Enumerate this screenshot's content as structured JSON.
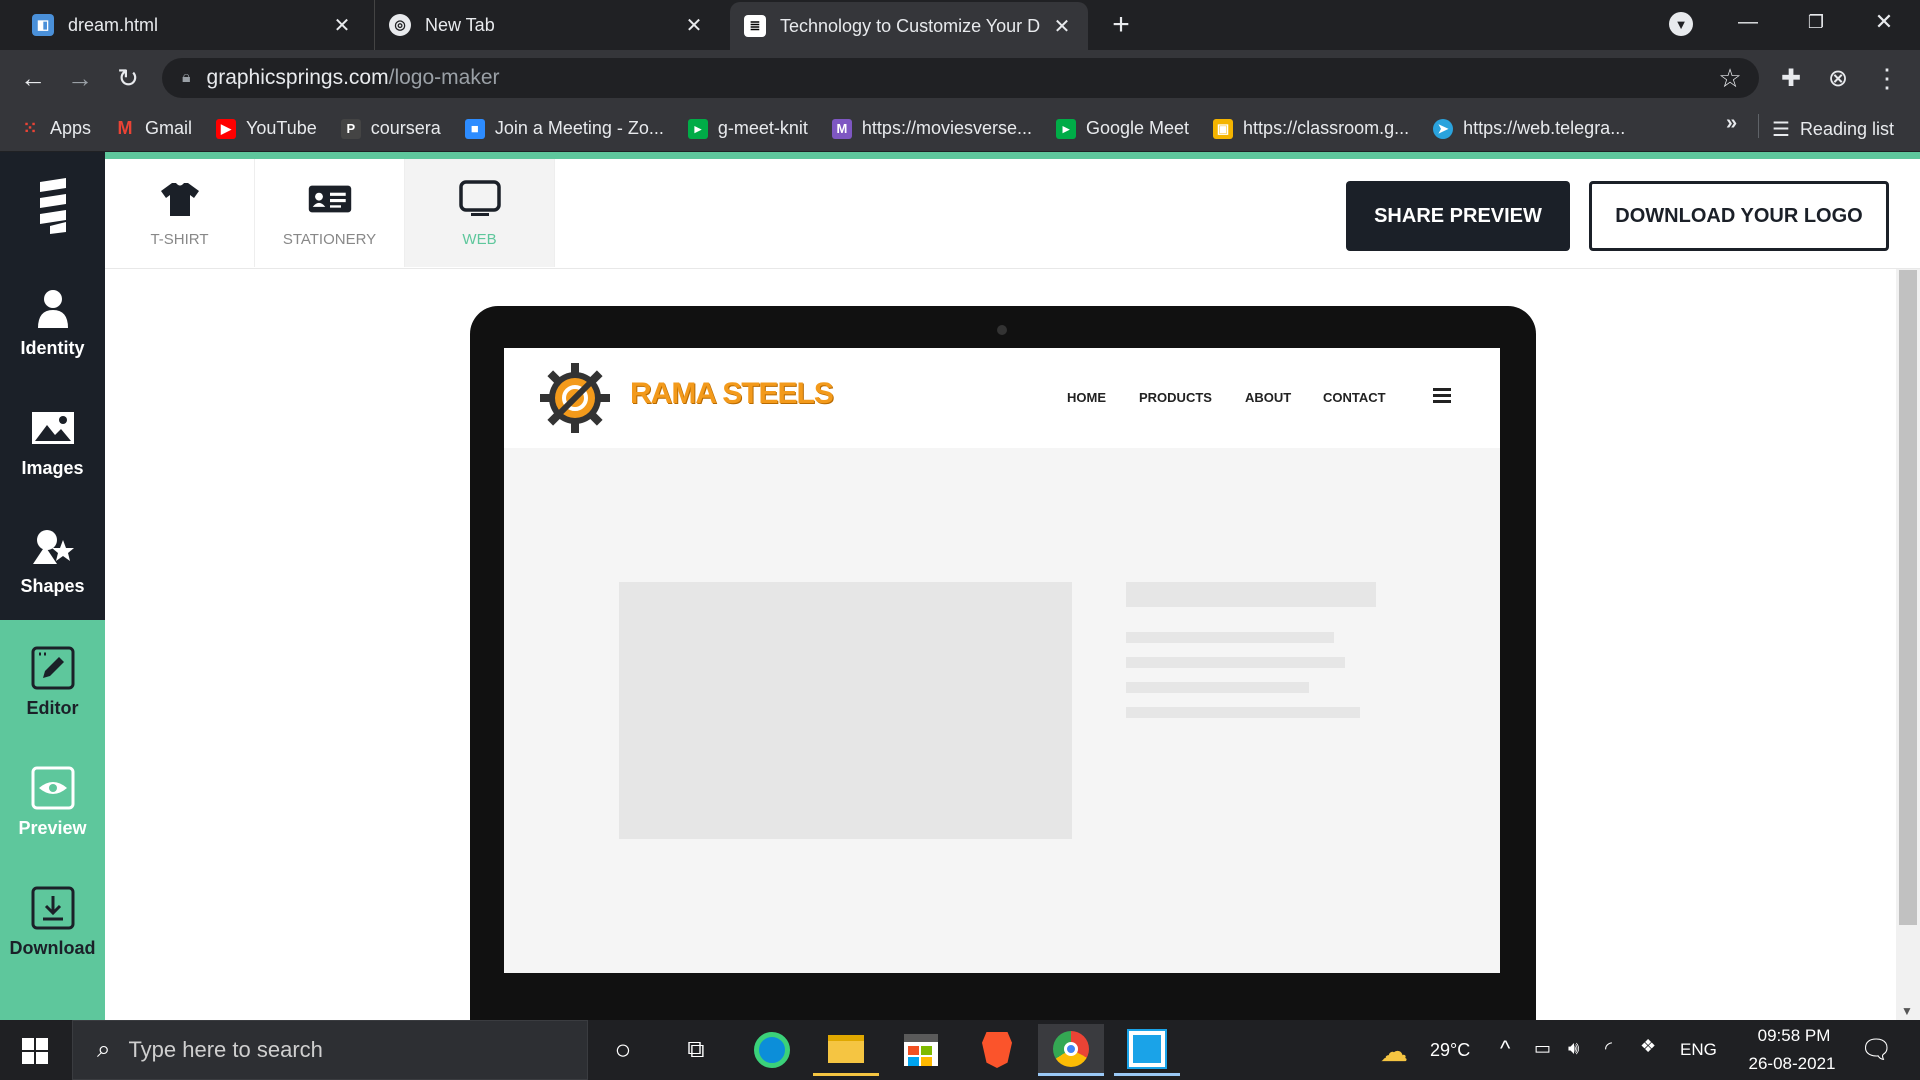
{
  "browser": {
    "tabs": [
      {
        "title": "dream.html",
        "icon": "document-icon"
      },
      {
        "title": "New Tab",
        "icon": "chrome-icon"
      },
      {
        "title": "Technology to Customize Your D",
        "icon": "graphicsprings-icon",
        "active": true
      }
    ],
    "url_host": "graphicsprings.com",
    "url_path": "/logo-maker",
    "bookmarks": [
      {
        "label": "Apps",
        "color": "#ea4335"
      },
      {
        "label": "Gmail",
        "color": "#ea4335"
      },
      {
        "label": "YouTube",
        "color": "#ff0000"
      },
      {
        "label": "coursera",
        "color": "#444444"
      },
      {
        "label": "Join a Meeting - Zo...",
        "color": "#2d8cff"
      },
      {
        "label": "g-meet-knit",
        "color": "#00ac47"
      },
      {
        "label": "https://moviesverse...",
        "color": "#7e57c2"
      },
      {
        "label": "Google Meet",
        "color": "#00ac47"
      },
      {
        "label": "https://classroom.g...",
        "color": "#f4b400"
      },
      {
        "label": "https://web.telegra...",
        "color": "#2aa3dd"
      }
    ],
    "more_bookmarks": "»",
    "reading_list": "Reading list"
  },
  "sidebar": {
    "top": [
      {
        "label": "Identity",
        "icon": "person-icon"
      },
      {
        "label": "Images",
        "icon": "image-icon"
      },
      {
        "label": "Shapes",
        "icon": "shapes-icon"
      }
    ],
    "bottom": [
      {
        "label": "Editor",
        "icon": "edit-icon"
      },
      {
        "label": "Preview",
        "icon": "eye-icon"
      },
      {
        "label": "Download",
        "icon": "download-icon"
      }
    ]
  },
  "preview_tabs": [
    {
      "label": "T-SHIRT",
      "icon": "tshirt-icon"
    },
    {
      "label": "STATIONERY",
      "icon": "id-card-icon"
    },
    {
      "label": "WEB",
      "icon": "monitor-icon",
      "active": true
    }
  ],
  "actions": {
    "share": "SHARE PREVIEW",
    "download": "DOWNLOAD YOUR LOGO"
  },
  "mock_site": {
    "brand": "RAMA STEELS",
    "nav": [
      "HOME",
      "PRODUCTS",
      "ABOUT",
      "CONTACT"
    ]
  },
  "taskbar": {
    "search_placeholder": "Type here to search",
    "weather": "29°C",
    "language": "ENG",
    "time": "09:58 PM",
    "date": "26-08-2021"
  },
  "colors": {
    "accent": "#5ec79c",
    "dark": "#1b2028",
    "brand_orange": "#f39a1b"
  }
}
